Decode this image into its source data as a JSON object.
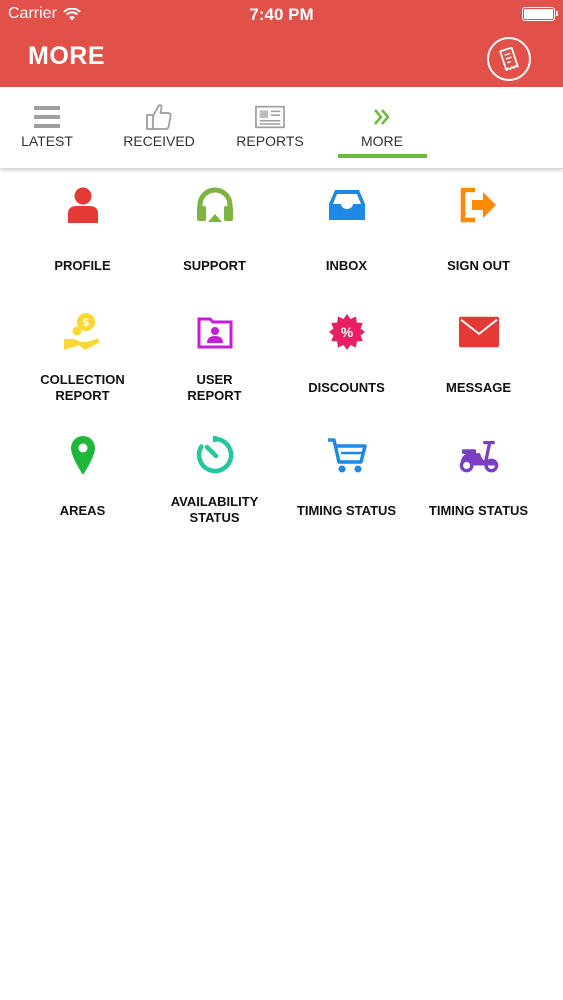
{
  "status_bar": {
    "carrier": "Carrier",
    "time": "7:40 PM"
  },
  "header": {
    "title": "MORE",
    "action_icon": "receipt-icon",
    "color": "#e2504a"
  },
  "tabs": [
    {
      "label": "LATEST",
      "icon": "menu-icon"
    },
    {
      "label": "RECEIVED",
      "icon": "thumbs-up-icon"
    },
    {
      "label": "REPORTS",
      "icon": "newspaper-icon"
    },
    {
      "label": "MORE",
      "icon": "double-chevron-right-icon",
      "active": true
    }
  ],
  "active_tab_color": "#6aba3b",
  "menu": [
    {
      "label": "PROFILE",
      "icon": "user-icon",
      "color": "#e53935"
    },
    {
      "label": "SUPPORT",
      "icon": "headset-icon",
      "color": "#7cb342"
    },
    {
      "label": "INBOX",
      "icon": "inbox-icon",
      "color": "#1e88e5"
    },
    {
      "label": "SIGN OUT",
      "icon": "sign-out-icon",
      "color": "#fb8c00"
    },
    {
      "label": "COLLECTION REPORT",
      "label_line1": "COLLECTION",
      "label_line2": "REPORT",
      "icon": "coin-hand-icon",
      "color": "#fdd835"
    },
    {
      "label": "USER REPORT",
      "label_line1": "USER",
      "label_line2": "REPORT",
      "icon": "user-folder-icon",
      "color": "#c51ed6"
    },
    {
      "label": "DISCOUNTS",
      "icon": "discount-badge-icon",
      "color": "#e91e63"
    },
    {
      "label": "MESSAGE",
      "icon": "envelope-icon",
      "color": "#e53935"
    },
    {
      "label": "AREAS",
      "icon": "map-pin-icon",
      "color": "#1fb73a"
    },
    {
      "label": "AVAILABILITY STATUS",
      "label_line1": "AVAILABILITY",
      "label_line2": "STATUS",
      "icon": "timer-icon",
      "color": "#26c6a0"
    },
    {
      "label": "TIMING STATUS",
      "icon": "cart-icon",
      "color": "#1e88e5"
    },
    {
      "label": "TIMING STATUS",
      "icon": "scooter-icon",
      "color": "#7b3fc4"
    }
  ]
}
